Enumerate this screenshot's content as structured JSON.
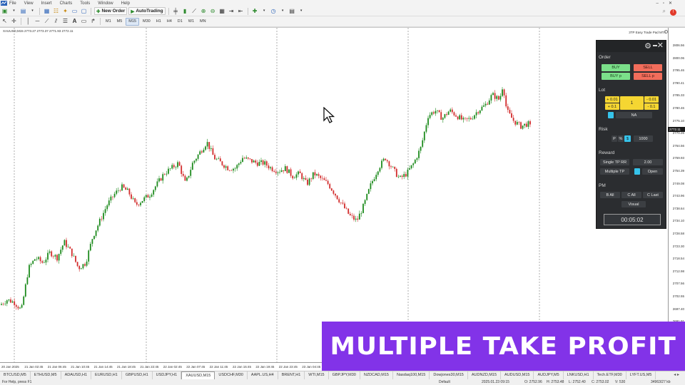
{
  "menu": [
    "File",
    "View",
    "Insert",
    "Charts",
    "Tools",
    "Window",
    "Help"
  ],
  "toolbar": {
    "new_order_label": "New Order",
    "auto_trading_label": "AutoTrading",
    "timeframes": [
      "M1",
      "M5",
      "M15",
      "M30",
      "H1",
      "H4",
      "D1",
      "W1",
      "MN"
    ],
    "active_timeframe": "M15"
  },
  "chart": {
    "header": "XAUUSD,M15  2773.27 2773.37 2771.93 2772.11",
    "ea_label": "3TP Easy Trade Pad MT4",
    "current_price": "2772.11",
    "y_ticks": [
      "2806.56",
      "2800.06",
      "2795.46",
      "2790.41",
      "2785.33",
      "2780.46",
      "2775.10",
      "2770.26",
      "2764.56",
      "2759.93",
      "2754.39",
      "2749.08",
      "2743.96",
      "2738.64",
      "2734.10",
      "2728.58",
      "2723.30",
      "2718.54",
      "2712.98",
      "2707.56",
      "2702.55",
      "2697.40",
      "2691.91",
      "2686.68"
    ],
    "x_ticks": [
      "20 Jan 2025",
      "21 Jan 02:45",
      "21 Jan 06:45",
      "21 Jan 10:45",
      "21 Jan 14:45",
      "21 Jan 18:45",
      "21 Jan 22:45",
      "22 Jan 02:45",
      "22 Jan 07:45",
      "22 Jan 11:45",
      "22 Jan 15:45",
      "22 Jan 19:45",
      "22 Jan 23:45",
      "23 Jan 04:45"
    ]
  },
  "chart_data": {
    "type": "candlestick",
    "symbol": "XAUUSD",
    "timeframe": "M15",
    "ylim": [
      2686.68,
      2806.56
    ],
    "close_path": [
      [
        0,
        2706
      ],
      [
        10,
        2708
      ],
      [
        20,
        2707
      ],
      [
        30,
        2704
      ],
      [
        40,
        2720
      ],
      [
        50,
        2724
      ],
      [
        60,
        2722
      ],
      [
        70,
        2726
      ],
      [
        80,
        2724
      ],
      [
        90,
        2730
      ],
      [
        100,
        2726
      ],
      [
        110,
        2720
      ],
      [
        120,
        2722
      ],
      [
        130,
        2732
      ],
      [
        140,
        2738
      ],
      [
        150,
        2744
      ],
      [
        160,
        2748
      ],
      [
        170,
        2751
      ],
      [
        180,
        2749
      ],
      [
        190,
        2744
      ],
      [
        200,
        2746
      ],
      [
        210,
        2748
      ],
      [
        220,
        2752
      ],
      [
        230,
        2756
      ],
      [
        240,
        2758
      ],
      [
        250,
        2760
      ],
      [
        260,
        2752
      ],
      [
        270,
        2760
      ],
      [
        280,
        2764
      ],
      [
        290,
        2768
      ],
      [
        300,
        2762
      ],
      [
        310,
        2760
      ],
      [
        320,
        2758
      ],
      [
        330,
        2758
      ],
      [
        340,
        2762
      ],
      [
        350,
        2761
      ],
      [
        360,
        2760
      ],
      [
        370,
        2760
      ],
      [
        380,
        2758
      ],
      [
        390,
        2757
      ],
      [
        400,
        2758
      ],
      [
        410,
        2755
      ],
      [
        420,
        2756
      ],
      [
        430,
        2752
      ],
      [
        440,
        2756
      ],
      [
        450,
        2754
      ],
      [
        460,
        2752
      ],
      [
        470,
        2748
      ],
      [
        480,
        2744
      ],
      [
        490,
        2740
      ],
      [
        500,
        2738
      ],
      [
        510,
        2744
      ],
      [
        520,
        2752
      ],
      [
        530,
        2758
      ],
      [
        540,
        2762
      ],
      [
        550,
        2758
      ],
      [
        560,
        2754
      ],
      [
        570,
        2756
      ],
      [
        580,
        2760
      ],
      [
        590,
        2766
      ],
      [
        600,
        2778
      ],
      [
        610,
        2780
      ],
      [
        620,
        2777
      ],
      [
        630,
        2780
      ],
      [
        640,
        2778
      ],
      [
        650,
        2776
      ],
      [
        660,
        2777
      ],
      [
        670,
        2780
      ],
      [
        680,
        2782
      ],
      [
        690,
        2786
      ],
      [
        700,
        2784
      ],
      [
        705,
        2790
      ],
      [
        710,
        2780
      ],
      [
        720,
        2776
      ],
      [
        730,
        2774
      ],
      [
        740,
        2775
      ],
      [
        745,
        2773
      ]
    ]
  },
  "panel": {
    "order_label": "Order",
    "buy": "BUY",
    "sell": "SELL",
    "buy_p": "BUY p",
    "sell_p": "SELL p",
    "lot_label": "Lot",
    "plus_001": "+ 0.01",
    "plus_01": "+ 0.1",
    "minus_001": "- 0.01",
    "minus_01": "- 0.1",
    "lot_value": "1",
    "na": "NA",
    "risk_label": "Risk",
    "risk_p": "P",
    "risk_pct": "%",
    "risk_dollar": "$",
    "risk_value": "1000",
    "reward_label": "Reward",
    "single_tp": "Single TP RR",
    "single_tp_value": "2.00",
    "multiple_tp": "Multiple TP",
    "open": "Open",
    "pm_label": "PM",
    "b_all": "B All",
    "c_all": "C All",
    "c_last": "C Last",
    "visual": "Visual",
    "timer": "00:05:02"
  },
  "tabs": [
    "BTCUSD,M5",
    "ETHUSD,M5",
    "ADAUSD,H1",
    "EURUSD,H1",
    "GBPUSD,H1",
    "USDJPY,H1",
    "XAUUSD,M15",
    "USDCHF,M30",
    "AAPL.US,H4",
    "BRENT,H1",
    "WTI,M15",
    "GBPJPY,M30",
    "NZDCAD,M15",
    "Nasdaq100,M15",
    "Dowjones30,M15",
    "AUDNZD,M15",
    "AUDUSD,M15",
    "AUDJPY,M5",
    "LNKUSD,H1",
    "Tech.ETF,M30",
    "LYFT.US,M5"
  ],
  "active_tab": "XAUUSD,M15",
  "status": {
    "help": "For Help, press F1",
    "profile": "Default",
    "datetime": "2025.01.23 09:15",
    "open": "O: 2752.96",
    "high": "H: 2753.48",
    "low": "L: 2752.40",
    "close": "C: 2753.02",
    "volume": "V: 530",
    "conn": "34963/27 kb"
  },
  "banner": {
    "text": "MULTIPLE TAKE PROFIT"
  }
}
